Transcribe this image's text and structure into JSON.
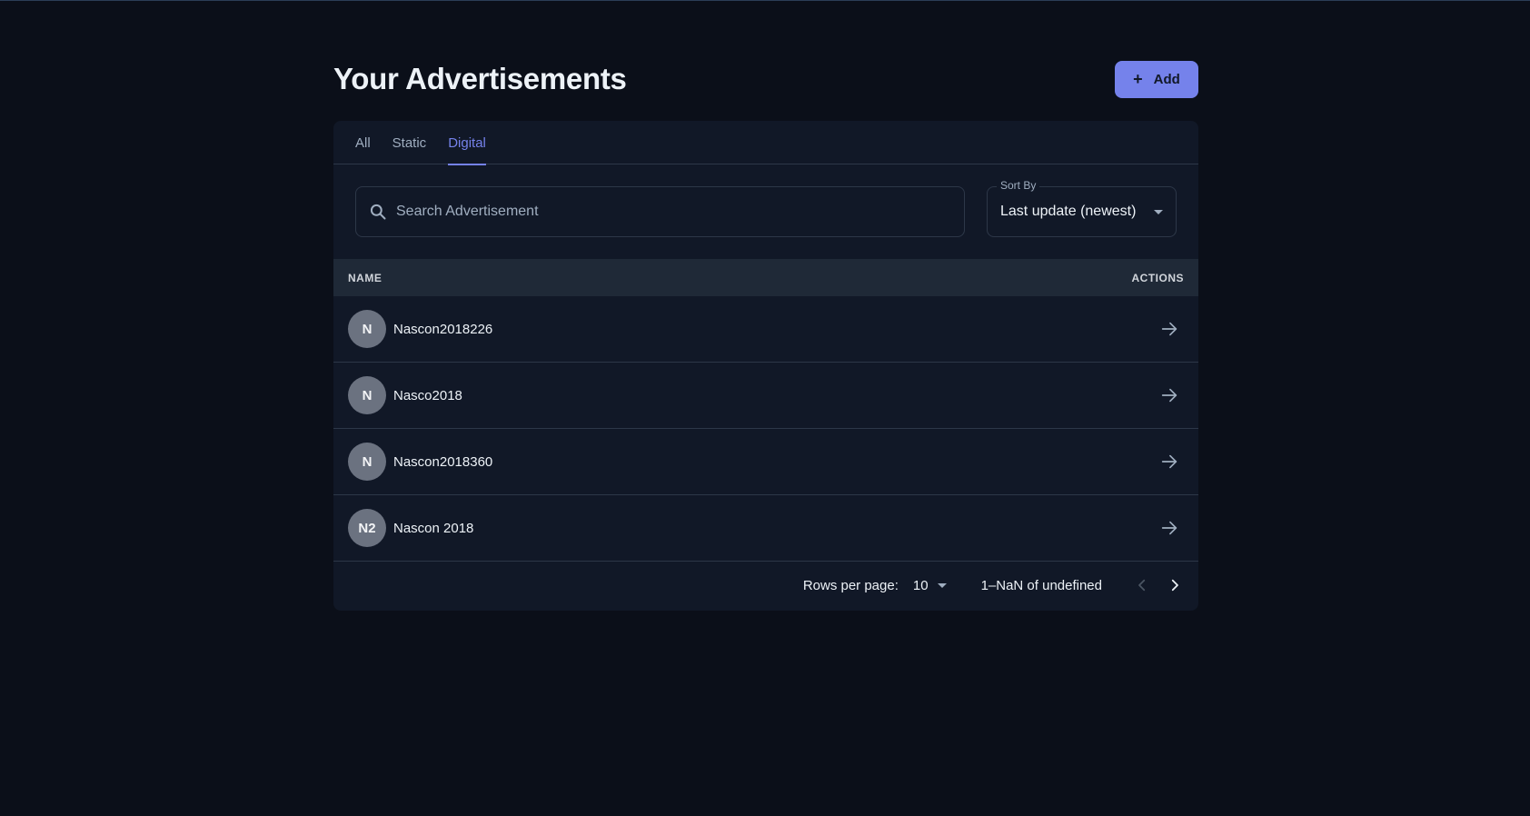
{
  "header": {
    "title": "Your Advertisements",
    "add_label": "Add"
  },
  "tabs": [
    {
      "label": "All",
      "active": false
    },
    {
      "label": "Static",
      "active": false
    },
    {
      "label": "Digital",
      "active": true
    }
  ],
  "search": {
    "placeholder": "Search Advertisement",
    "value": ""
  },
  "sort": {
    "label": "Sort By",
    "value": "Last update (newest)"
  },
  "table": {
    "columns": [
      "NAME",
      "ACTIONS"
    ],
    "rows": [
      {
        "initials": "N",
        "name": "Nascon2018226"
      },
      {
        "initials": "N",
        "name": "Nasco2018"
      },
      {
        "initials": "N",
        "name": "Nascon2018360"
      },
      {
        "initials": "N2",
        "name": "Nascon 2018"
      }
    ]
  },
  "pagination": {
    "rows_per_page_label": "Rows per page:",
    "rows_per_page": "10",
    "range": "1–NaN of undefined"
  },
  "colors": {
    "background": "#0b0f19",
    "card": "#111827",
    "accent": "#7582eb",
    "avatar": "#6b7280"
  },
  "icons": {
    "search": "search-icon",
    "row_action": "arrow-right-icon",
    "prev": "chevron-left-icon",
    "next": "chevron-right-icon"
  }
}
